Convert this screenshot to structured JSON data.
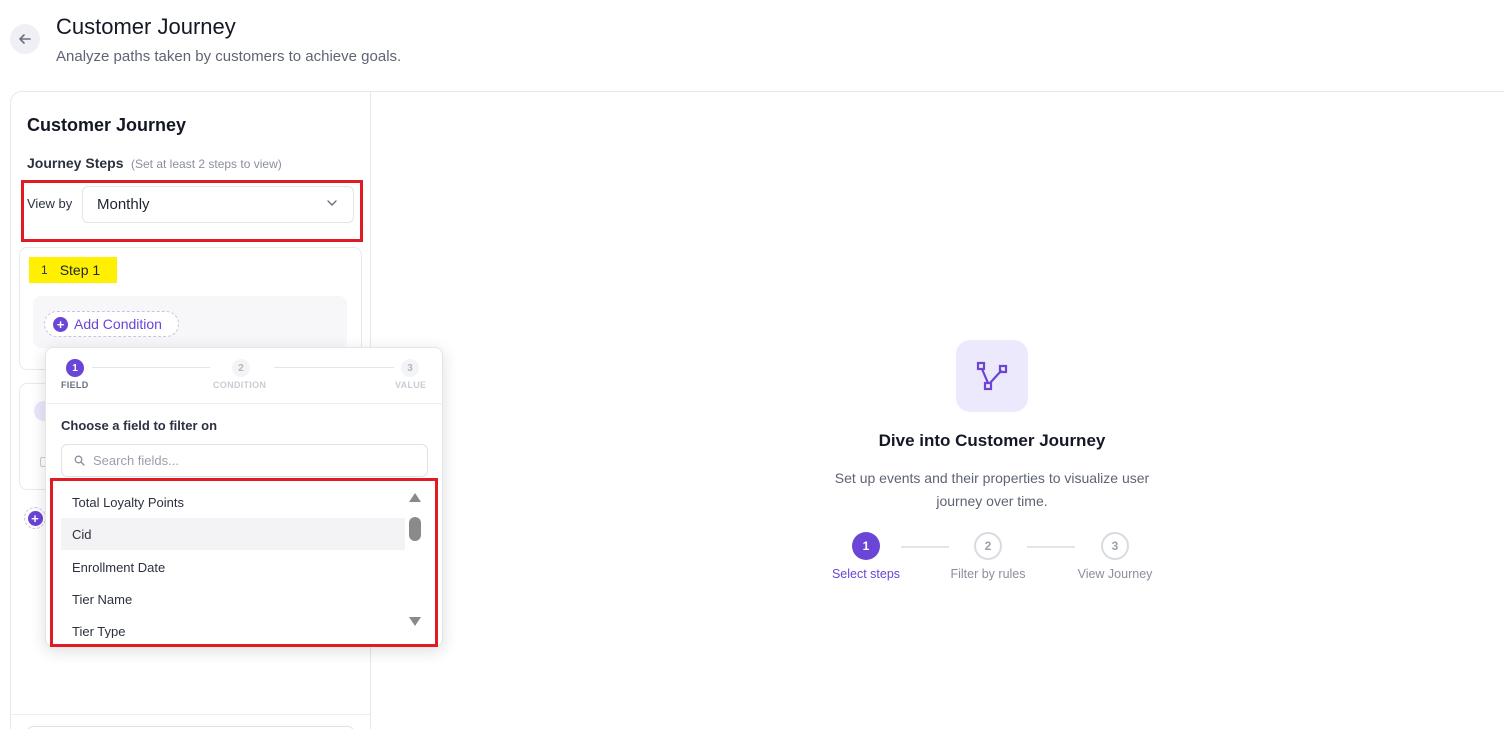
{
  "header": {
    "title": "Customer Journey",
    "subtitle": "Analyze paths taken by customers to achieve goals."
  },
  "left_panel": {
    "title": "Customer Journey",
    "steps_label": "Journey Steps",
    "steps_hint": "(Set at least 2 steps to view)",
    "view_by_label": "View by",
    "view_by_value": "Monthly",
    "step1": {
      "number": "1",
      "name": "Step 1",
      "add_condition_label": "Add Condition"
    }
  },
  "popup": {
    "wizard": [
      {
        "number": "1",
        "label": "FIELD"
      },
      {
        "number": "2",
        "label": "CONDITION"
      },
      {
        "number": "3",
        "label": "VALUE"
      }
    ],
    "heading": "Choose a field to filter on",
    "search_placeholder": "Search fields...",
    "fields": [
      "Total Loyalty Points",
      "Cid",
      "Enrollment Date",
      "Tier Name",
      "Tier Type"
    ],
    "hovered_field": "Cid"
  },
  "empty_state": {
    "title": "Dive into Customer Journey",
    "desc_line1": "Set up events and their properties to visualize user",
    "desc_line2": "journey over time.",
    "steps": [
      {
        "number": "1",
        "label": "Select steps"
      },
      {
        "number": "2",
        "label": "Filter by rules"
      },
      {
        "number": "3",
        "label": "View Journey"
      }
    ]
  },
  "colors": {
    "accent": "#6a45d6",
    "highlight_box": "#e01b24",
    "step_tag": "#ffef00"
  }
}
